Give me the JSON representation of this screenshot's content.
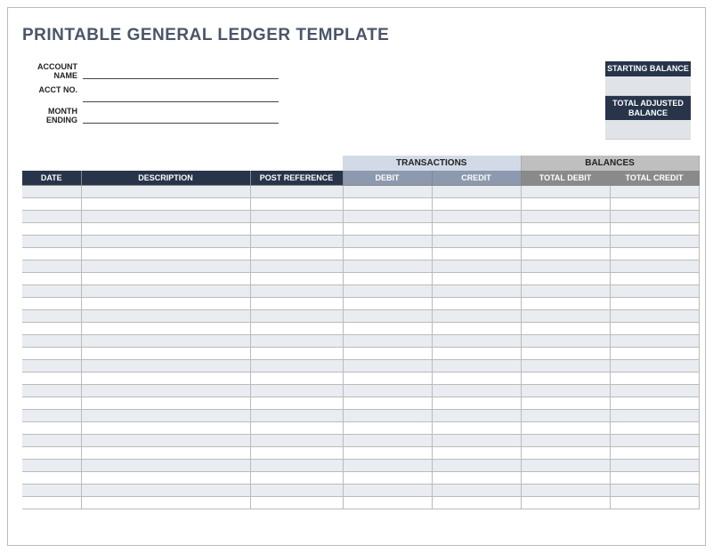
{
  "title": "PRINTABLE GENERAL LEDGER TEMPLATE",
  "fields": {
    "account_name_label": "ACCOUNT NAME",
    "account_name_value": "",
    "acct_no_label": "ACCT NO.",
    "acct_no_value": "",
    "month_ending_label": "MONTH ENDING",
    "month_ending_value": ""
  },
  "balances_box": {
    "starting_label": "STARTING BALANCE",
    "starting_value": "",
    "adjusted_label": "TOTAL ADJUSTED BALANCE",
    "adjusted_value": ""
  },
  "table": {
    "super_headers": {
      "transactions": "TRANSACTIONS",
      "balances": "BALANCES"
    },
    "headers": {
      "date": "DATE",
      "description": "DESCRIPTION",
      "post_reference": "POST REFERENCE",
      "debit": "DEBIT",
      "credit": "CREDIT",
      "total_debit": "TOTAL DEBIT",
      "total_credit": "TOTAL CREDIT"
    },
    "rows": [
      {
        "date": "",
        "description": "",
        "post_reference": "",
        "debit": "",
        "credit": "",
        "total_debit": "",
        "total_credit": ""
      },
      {
        "date": "",
        "description": "",
        "post_reference": "",
        "debit": "",
        "credit": "",
        "total_debit": "",
        "total_credit": ""
      },
      {
        "date": "",
        "description": "",
        "post_reference": "",
        "debit": "",
        "credit": "",
        "total_debit": "",
        "total_credit": ""
      },
      {
        "date": "",
        "description": "",
        "post_reference": "",
        "debit": "",
        "credit": "",
        "total_debit": "",
        "total_credit": ""
      },
      {
        "date": "",
        "description": "",
        "post_reference": "",
        "debit": "",
        "credit": "",
        "total_debit": "",
        "total_credit": ""
      },
      {
        "date": "",
        "description": "",
        "post_reference": "",
        "debit": "",
        "credit": "",
        "total_debit": "",
        "total_credit": ""
      },
      {
        "date": "",
        "description": "",
        "post_reference": "",
        "debit": "",
        "credit": "",
        "total_debit": "",
        "total_credit": ""
      },
      {
        "date": "",
        "description": "",
        "post_reference": "",
        "debit": "",
        "credit": "",
        "total_debit": "",
        "total_credit": ""
      },
      {
        "date": "",
        "description": "",
        "post_reference": "",
        "debit": "",
        "credit": "",
        "total_debit": "",
        "total_credit": ""
      },
      {
        "date": "",
        "description": "",
        "post_reference": "",
        "debit": "",
        "credit": "",
        "total_debit": "",
        "total_credit": ""
      },
      {
        "date": "",
        "description": "",
        "post_reference": "",
        "debit": "",
        "credit": "",
        "total_debit": "",
        "total_credit": ""
      },
      {
        "date": "",
        "description": "",
        "post_reference": "",
        "debit": "",
        "credit": "",
        "total_debit": "",
        "total_credit": ""
      },
      {
        "date": "",
        "description": "",
        "post_reference": "",
        "debit": "",
        "credit": "",
        "total_debit": "",
        "total_credit": ""
      },
      {
        "date": "",
        "description": "",
        "post_reference": "",
        "debit": "",
        "credit": "",
        "total_debit": "",
        "total_credit": ""
      },
      {
        "date": "",
        "description": "",
        "post_reference": "",
        "debit": "",
        "credit": "",
        "total_debit": "",
        "total_credit": ""
      },
      {
        "date": "",
        "description": "",
        "post_reference": "",
        "debit": "",
        "credit": "",
        "total_debit": "",
        "total_credit": ""
      },
      {
        "date": "",
        "description": "",
        "post_reference": "",
        "debit": "",
        "credit": "",
        "total_debit": "",
        "total_credit": ""
      },
      {
        "date": "",
        "description": "",
        "post_reference": "",
        "debit": "",
        "credit": "",
        "total_debit": "",
        "total_credit": ""
      },
      {
        "date": "",
        "description": "",
        "post_reference": "",
        "debit": "",
        "credit": "",
        "total_debit": "",
        "total_credit": ""
      },
      {
        "date": "",
        "description": "",
        "post_reference": "",
        "debit": "",
        "credit": "",
        "total_debit": "",
        "total_credit": ""
      },
      {
        "date": "",
        "description": "",
        "post_reference": "",
        "debit": "",
        "credit": "",
        "total_debit": "",
        "total_credit": ""
      },
      {
        "date": "",
        "description": "",
        "post_reference": "",
        "debit": "",
        "credit": "",
        "total_debit": "",
        "total_credit": ""
      },
      {
        "date": "",
        "description": "",
        "post_reference": "",
        "debit": "",
        "credit": "",
        "total_debit": "",
        "total_credit": ""
      },
      {
        "date": "",
        "description": "",
        "post_reference": "",
        "debit": "",
        "credit": "",
        "total_debit": "",
        "total_credit": ""
      },
      {
        "date": "",
        "description": "",
        "post_reference": "",
        "debit": "",
        "credit": "",
        "total_debit": "",
        "total_credit": ""
      },
      {
        "date": "",
        "description": "",
        "post_reference": "",
        "debit": "",
        "credit": "",
        "total_debit": "",
        "total_credit": ""
      }
    ]
  }
}
